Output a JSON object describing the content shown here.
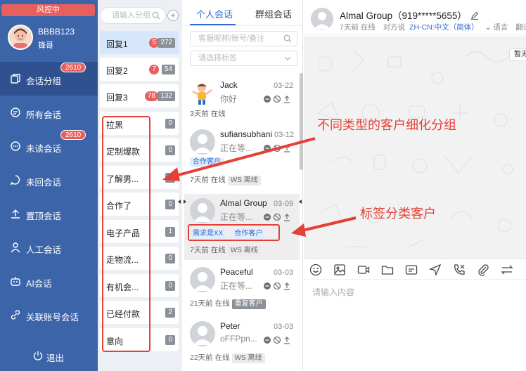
{
  "sidebar": {
    "risk_label": "风控中",
    "user_name": "BBBB123",
    "user_sub": "锋哥",
    "nav": [
      {
        "label": "会话分组",
        "icon": "copy-icon",
        "badge": "2610",
        "active": true
      },
      {
        "label": "所有会话",
        "icon": "chat-bubble-icon",
        "badge": "",
        "active": false
      },
      {
        "label": "未读会话",
        "icon": "chat-dots-icon",
        "badge": "2610",
        "active": false
      },
      {
        "label": "未回会话",
        "icon": "chat-circle-icon",
        "badge": "",
        "active": false
      },
      {
        "label": "置顶会话",
        "icon": "pin-top-icon",
        "badge": "",
        "active": false
      },
      {
        "label": "人工会话",
        "icon": "person-icon",
        "badge": "",
        "active": false
      },
      {
        "label": "AI会话",
        "icon": "robot-icon",
        "badge": "",
        "active": false
      },
      {
        "label": "关联账号会话",
        "icon": "link-icon",
        "badge": "",
        "active": false
      }
    ],
    "logout_label": "退出"
  },
  "groups": {
    "search_placeholder": "请输入分组",
    "add_label": "+",
    "items": [
      {
        "label": "回复1",
        "unread": "5",
        "count": "272",
        "selected": true
      },
      {
        "label": "回复2",
        "unread": "7",
        "count": "54",
        "selected": false
      },
      {
        "label": "回复3",
        "unread": "78",
        "count": "132",
        "selected": false
      },
      {
        "label": "拉黑",
        "unread": "",
        "count": "0",
        "selected": false
      },
      {
        "label": "定制爆款",
        "unread": "",
        "count": "0",
        "selected": false
      },
      {
        "label": "了解男...",
        "unread": "",
        "count": "0",
        "selected": false
      },
      {
        "label": "合作了",
        "unread": "",
        "count": "0",
        "selected": false
      },
      {
        "label": "电子产品",
        "unread": "",
        "count": "1",
        "selected": false
      },
      {
        "label": "走物流...",
        "unread": "",
        "count": "0",
        "selected": false
      },
      {
        "label": "有机会...",
        "unread": "",
        "count": "0",
        "selected": false
      },
      {
        "label": "已经付款",
        "unread": "",
        "count": "2",
        "selected": false
      },
      {
        "label": "意向",
        "unread": "",
        "count": "0",
        "selected": false
      }
    ]
  },
  "chatlist": {
    "tabs": [
      "个人会话",
      "群组会话"
    ],
    "search_placeholder": "客服昵称/账号/备注",
    "tag_placeholder": "请选择标签",
    "chats": [
      {
        "name": "Jack",
        "date": "03-22",
        "preview": "你好",
        "status": "3天前 在线",
        "chips": []
      },
      {
        "name": "sufiansubhani",
        "date": "03-12",
        "preview": "正在等...",
        "status": "7天前 在线",
        "chips": [
          {
            "text": "WS 离线",
            "style": "gray"
          }
        ],
        "tags": [
          "合作客户"
        ]
      },
      {
        "name": "Almal Group",
        "date": "03-09",
        "preview": "正在等...",
        "status": "7天前 在线",
        "chips": [
          {
            "text": "WS 离线",
            "style": "gray"
          }
        ],
        "tags": [
          "需求是XX",
          "合作客户"
        ]
      },
      {
        "name": "Peaceful",
        "date": "03-03",
        "preview": "正在等...",
        "status": "21天前 在线",
        "chips": [
          {
            "text": "重复客户",
            "style": "dark"
          }
        ]
      },
      {
        "name": "Peter",
        "date": "03-03",
        "preview": "oFFPpn...",
        "status": "22天前 在线",
        "chips": [
          {
            "text": "WS 离线",
            "style": "gray"
          }
        ]
      }
    ]
  },
  "conversation": {
    "title": "Almal Group（919*****5655）",
    "last_seen": "7天前 在线",
    "speaker_label": "对方说",
    "lang_code": "ZH-CN:中文（简体）",
    "lang_label": "语言",
    "translate_label": "翻译済",
    "pause_label": "暂无",
    "input_placeholder": "请输入内容",
    "tools": [
      "emoji-icon",
      "image-icon",
      "video-icon",
      "folder-icon",
      "card-icon",
      "location-icon",
      "call-icon",
      "attach-icon",
      "transfer-icon"
    ]
  },
  "annotations": {
    "group_note": "不同类型的客户细化分组",
    "tag_note": "标签分类客户"
  },
  "colors": {
    "sidebar_bg": "#3c65a9",
    "accent": "#2e6bd6",
    "badge_red": "#e8605e",
    "annotation_red": "#e53f36"
  }
}
